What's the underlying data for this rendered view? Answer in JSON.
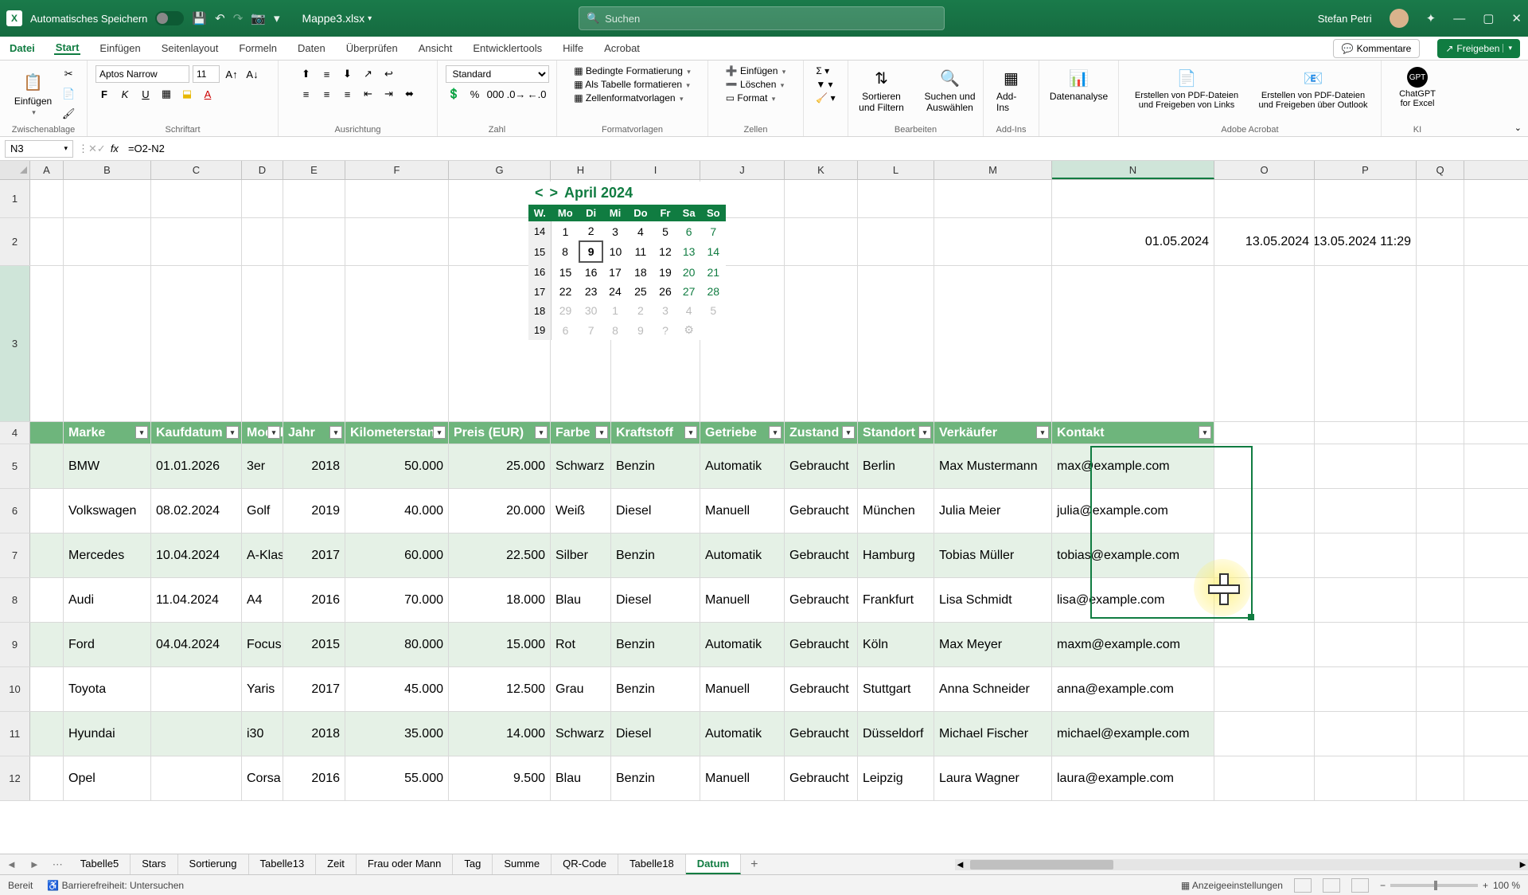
{
  "title": {
    "autosave": "Automatisches Speichern",
    "filename": "Mappe3.xlsx",
    "search_placeholder": "Suchen",
    "user": "Stefan Petri"
  },
  "menu": {
    "file": "Datei",
    "tabs": [
      "Start",
      "Einfügen",
      "Seitenlayout",
      "Formeln",
      "Daten",
      "Überprüfen",
      "Ansicht",
      "Entwicklertools",
      "Hilfe",
      "Acrobat"
    ],
    "active": "Start",
    "comments": "Kommentare",
    "share": "Freigeben"
  },
  "ribbon": {
    "clipboard": {
      "paste": "Einfügen",
      "label": "Zwischenablage"
    },
    "font": {
      "name": "Aptos Narrow",
      "size": "11",
      "label": "Schriftart"
    },
    "align": {
      "label": "Ausrichtung"
    },
    "number": {
      "format": "Standard",
      "label": "Zahl"
    },
    "styles": {
      "cond": "Bedingte Formatierung",
      "table": "Als Tabelle formatieren",
      "cellstyles": "Zellenformatvorlagen",
      "label": "Formatvorlagen"
    },
    "cells": {
      "insert": "Einfügen",
      "delete": "Löschen",
      "format": "Format",
      "label": "Zellen"
    },
    "editing": {
      "sortfilter": "Sortieren und Filtern",
      "findselect": "Suchen und Auswählen",
      "label": "Bearbeiten"
    },
    "addins": {
      "addins": "Add-Ins",
      "label": "Add-Ins"
    },
    "analysis": {
      "btn": "Datenanalyse"
    },
    "acrobat": {
      "pdf1": "Erstellen von PDF-Dateien und Freigeben von Links",
      "pdf2": "Erstellen von PDF-Dateien und Freigeben über Outlook",
      "label": "Adobe Acrobat"
    },
    "ai": {
      "gpt": "ChatGPT for Excel",
      "label": "KI"
    }
  },
  "formula": {
    "cellref": "N3",
    "value": "=O2-N2"
  },
  "columns": [
    "A",
    "B",
    "C",
    "D",
    "E",
    "F",
    "G",
    "H",
    "I",
    "J",
    "K",
    "L",
    "M",
    "N",
    "O",
    "P",
    "Q"
  ],
  "row2": {
    "n": "01.05.2024",
    "o": "13.05.2024",
    "p": "13.05.2024 11:29"
  },
  "calendar": {
    "month": "April 2024",
    "dow": [
      "W.",
      "Mo",
      "Di",
      "Mi",
      "Do",
      "Fr",
      "Sa",
      "So"
    ],
    "weeks": [
      {
        "wk": "14",
        "d": [
          "1",
          "2",
          "3",
          "4",
          "5",
          "6",
          "7"
        ]
      },
      {
        "wk": "15",
        "d": [
          "8",
          "9",
          "10",
          "11",
          "12",
          "13",
          "14"
        ]
      },
      {
        "wk": "16",
        "d": [
          "15",
          "16",
          "17",
          "18",
          "19",
          "20",
          "21"
        ]
      },
      {
        "wk": "17",
        "d": [
          "22",
          "23",
          "24",
          "25",
          "26",
          "27",
          "28"
        ]
      },
      {
        "wk": "18",
        "d": [
          "29",
          "30",
          "1",
          "2",
          "3",
          "4",
          "5"
        ]
      },
      {
        "wk": "19",
        "d": [
          "6",
          "7",
          "8",
          "9",
          "?",
          "⚙",
          ""
        ]
      }
    ],
    "today": "9"
  },
  "table": {
    "headers": [
      "Marke",
      "Kaufdatum",
      "Modell",
      "Jahr",
      "Kilometerstand",
      "Preis (EUR)",
      "Farbe",
      "Kraftstoff",
      "Getriebe",
      "Zustand",
      "Standort",
      "Verkäufer",
      "Kontakt"
    ],
    "rows": [
      [
        "BMW",
        "01.01.2026",
        "3er",
        "2018",
        "50.000",
        "25.000",
        "Schwarz",
        "Benzin",
        "Automatik",
        "Gebraucht",
        "Berlin",
        "Max Mustermann",
        "max@example.com"
      ],
      [
        "Volkswagen",
        "08.02.2024",
        "Golf",
        "2019",
        "40.000",
        "20.000",
        "Weiß",
        "Diesel",
        "Manuell",
        "Gebraucht",
        "München",
        "Julia Meier",
        "julia@example.com"
      ],
      [
        "Mercedes",
        "10.04.2024",
        "A-Klasse",
        "2017",
        "60.000",
        "22.500",
        "Silber",
        "Benzin",
        "Automatik",
        "Gebraucht",
        "Hamburg",
        "Tobias Müller",
        "tobias@example.com"
      ],
      [
        "Audi",
        "11.04.2024",
        "A4",
        "2016",
        "70.000",
        "18.000",
        "Blau",
        "Diesel",
        "Manuell",
        "Gebraucht",
        "Frankfurt",
        "Lisa Schmidt",
        "lisa@example.com"
      ],
      [
        "Ford",
        "04.04.2024",
        "Focus",
        "2015",
        "80.000",
        "15.000",
        "Rot",
        "Benzin",
        "Automatik",
        "Gebraucht",
        "Köln",
        "Max Meyer",
        "maxm@example.com"
      ],
      [
        "Toyota",
        "",
        "Yaris",
        "2017",
        "45.000",
        "12.500",
        "Grau",
        "Benzin",
        "Manuell",
        "Gebraucht",
        "Stuttgart",
        "Anna Schneider",
        "anna@example.com"
      ],
      [
        "Hyundai",
        "",
        "i30",
        "2018",
        "35.000",
        "14.000",
        "Schwarz",
        "Diesel",
        "Automatik",
        "Gebraucht",
        "Düsseldorf",
        "Michael Fischer",
        "michael@example.com"
      ],
      [
        "Opel",
        "",
        "Corsa",
        "2016",
        "55.000",
        "9.500",
        "Blau",
        "Benzin",
        "Manuell",
        "Gebraucht",
        "Leipzig",
        "Laura Wagner",
        "laura@example.com"
      ]
    ]
  },
  "sheets": {
    "tabs": [
      "Tabelle5",
      "Stars",
      "Sortierung",
      "Tabelle13",
      "Zeit",
      "Frau oder Mann",
      "Tag",
      "Summe",
      "QR-Code",
      "Tabelle18",
      "Datum"
    ],
    "active": "Datum"
  },
  "status": {
    "ready": "Bereit",
    "access": "Barrierefreiheit: Untersuchen",
    "display": "Anzeigeeinstellungen",
    "zoom": "100 %"
  }
}
